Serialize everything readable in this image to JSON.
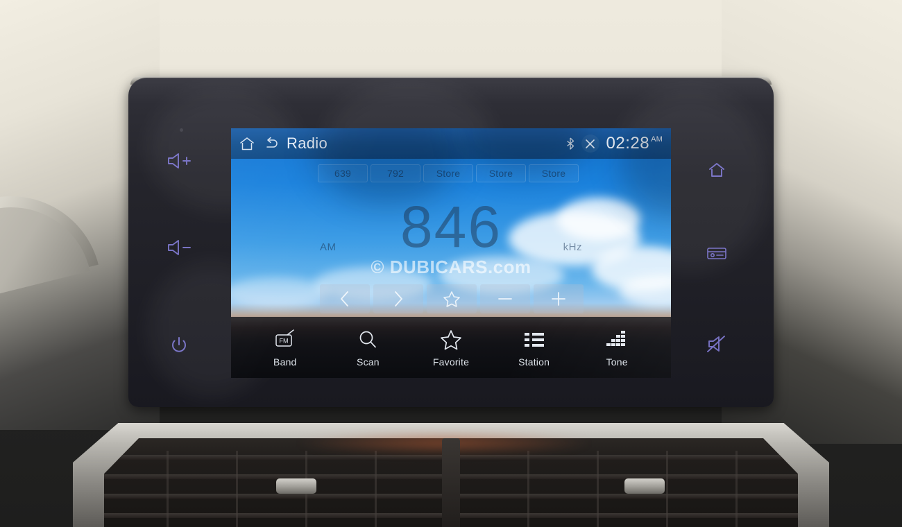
{
  "device": {
    "type": "car-infotainment-touchscreen",
    "bezel_color": "#22222a",
    "accent_color": "#8d86e8"
  },
  "status_bar": {
    "home_icon": "home-icon",
    "back_icon": "back-arrow-icon",
    "title": "Radio",
    "bluetooth_icon": "bluetooth-icon",
    "close_icon": "close-x-icon",
    "time": "02:28",
    "meridiem": "AM",
    "background_color": "#14518f"
  },
  "presets": [
    {
      "label": "639",
      "stored": true
    },
    {
      "label": "792",
      "stored": true
    },
    {
      "label": "Store",
      "stored": false
    },
    {
      "label": "Store",
      "stored": false
    },
    {
      "label": "Store",
      "stored": false
    }
  ],
  "tuner": {
    "band": "AM",
    "frequency": "846",
    "unit": "kHz"
  },
  "watermark": "© DUBICARS.com",
  "controls": [
    {
      "name": "seek-down-button",
      "icon": "chevron-left-icon"
    },
    {
      "name": "seek-up-button",
      "icon": "chevron-right-icon"
    },
    {
      "name": "favorite-toggle-button",
      "icon": "star-outline-icon"
    },
    {
      "name": "tune-down-button",
      "icon": "minus-icon"
    },
    {
      "name": "tune-up-button",
      "icon": "plus-icon"
    }
  ],
  "bottom_nav": [
    {
      "label": "Band",
      "icon": "fm-radio-icon"
    },
    {
      "label": "Scan",
      "icon": "search-icon"
    },
    {
      "label": "Favorite",
      "icon": "star-outline-icon"
    },
    {
      "label": "Station",
      "icon": "list-icon"
    },
    {
      "label": "Tone",
      "icon": "equalizer-icon"
    }
  ],
  "hardware_buttons": [
    {
      "name": "volume-up-button",
      "icon": "speaker-plus-icon",
      "side": "left"
    },
    {
      "name": "volume-down-button",
      "icon": "speaker-minus-icon",
      "side": "left"
    },
    {
      "name": "power-button",
      "icon": "power-icon",
      "side": "left"
    },
    {
      "name": "home-hardware-button",
      "icon": "home-icon",
      "side": "right"
    },
    {
      "name": "media-hardware-button",
      "icon": "radio-icon",
      "side": "right"
    },
    {
      "name": "mute-hardware-button",
      "icon": "speaker-mute-icon",
      "side": "right"
    }
  ]
}
